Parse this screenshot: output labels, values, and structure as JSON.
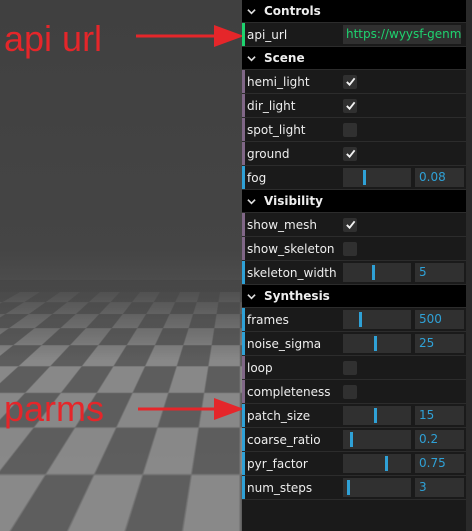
{
  "annotations": {
    "api_url_note": "api url",
    "parms_note": "parms"
  },
  "controls": {
    "title": "Controls",
    "api_url": {
      "label": "api_url",
      "value": "https://wyysf-genmm"
    }
  },
  "scene": {
    "title": "Scene",
    "hemi_light": {
      "label": "hemi_light",
      "checked": true
    },
    "dir_light": {
      "label": "dir_light",
      "checked": true
    },
    "spot_light": {
      "label": "spot_light",
      "checked": false
    },
    "ground": {
      "label": "ground",
      "checked": true
    },
    "fog": {
      "label": "fog",
      "value": "0.08",
      "fraction": 0.3
    }
  },
  "visibility": {
    "title": "Visibility",
    "show_mesh": {
      "label": "show_mesh",
      "checked": true
    },
    "show_skeleton": {
      "label": "show_skeleton",
      "checked": false
    },
    "skeleton_width": {
      "label": "skeleton_width",
      "value": "5",
      "fraction": 0.45
    }
  },
  "synthesis": {
    "title": "Synthesis",
    "frames": {
      "label": "frames",
      "value": "500",
      "fraction": 0.25
    },
    "noise_sigma": {
      "label": "noise_sigma",
      "value": "25",
      "fraction": 0.48
    },
    "loop": {
      "label": "loop",
      "checked": false
    },
    "completeness": {
      "label": "completeness",
      "checked": false
    },
    "patch_size": {
      "label": "patch_size",
      "value": "15",
      "fraction": 0.48
    },
    "coarse_ratio": {
      "label": "coarse_ratio",
      "value": "0.2",
      "fraction": 0.1
    },
    "pyr_factor": {
      "label": "pyr_factor",
      "value": "0.75",
      "fraction": 0.65
    },
    "num_steps": {
      "label": "num_steps",
      "value": "3",
      "fraction": 0.06
    }
  },
  "colors": {
    "number_accent": "#2fa1d6",
    "string_accent": "#1ed36f",
    "bool_accent": "#806787",
    "annotation": "#e5262a"
  }
}
